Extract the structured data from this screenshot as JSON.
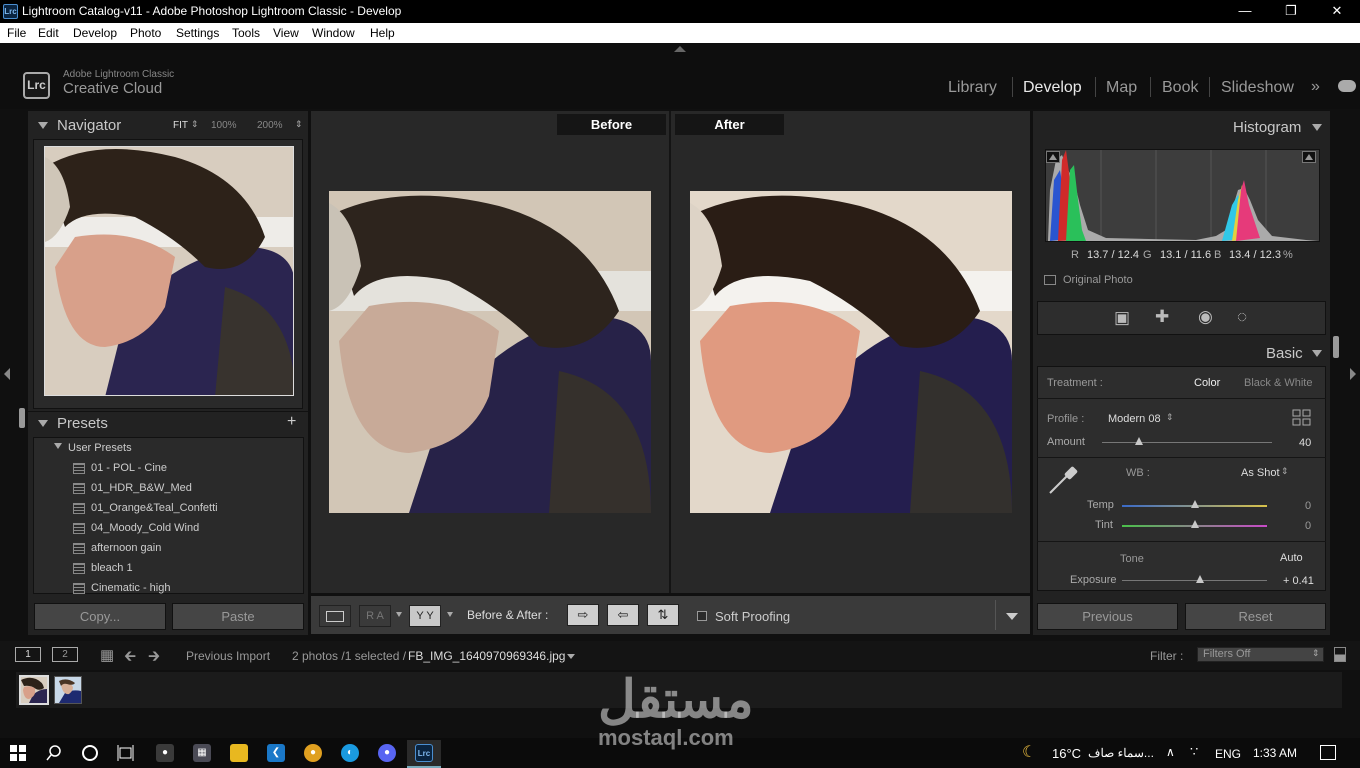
{
  "window": {
    "title": "Lightroom Catalog-v11 - Adobe Photoshop Lightroom Classic - Develop",
    "app_icon": "Lrc"
  },
  "menu": [
    "File",
    "Edit",
    "Develop",
    "Photo",
    "Settings",
    "Tools",
    "View",
    "Window",
    "Help"
  ],
  "identity": {
    "logo": "Lrc",
    "line1": "Adobe Lightroom Classic",
    "line2": "Creative Cloud"
  },
  "modules": [
    "Library",
    "Develop",
    "Map",
    "Book",
    "Slideshow"
  ],
  "active_module": "Develop",
  "navigator": {
    "title": "Navigator",
    "fit": "FIT",
    "zoom1": "100%",
    "zoom2": "200%"
  },
  "presets": {
    "title": "Presets",
    "group": "User Presets",
    "items": [
      "01 - POL - Cine",
      "01_HDR_B&W_Med",
      "01_Orange&Teal_Confetti",
      "04_Moody_Cold Wind",
      "afternoon gain",
      "bleach 1",
      "Cinematic - high"
    ]
  },
  "left_buttons": {
    "copy": "Copy...",
    "paste": "Paste"
  },
  "compare": {
    "before": "Before",
    "after": "After"
  },
  "toolbar": {
    "before_after": "Before & After :",
    "soft_proofing": "Soft Proofing",
    "ra": "R A",
    "yy": "Y Y"
  },
  "histogram": {
    "title": "Histogram",
    "r_label": "R",
    "r_value": "13.7 / 12.4",
    "g_label": "G",
    "g_value": "13.1 / 11.6",
    "b_label": "B",
    "b_value": "13.4 / 12.3",
    "pct": "%",
    "original_photo": "Original Photo"
  },
  "basic": {
    "title": "Basic",
    "treatment_label": "Treatment :",
    "treatment_color": "Color",
    "treatment_bw": "Black & White",
    "profile_label": "Profile :",
    "profile_value": "Modern 08",
    "amount_label": "Amount",
    "amount_value": "40",
    "wb_label": "WB :",
    "wb_value": "As Shot",
    "temp_label": "Temp",
    "temp_value": "0",
    "tint_label": "Tint",
    "tint_value": "0",
    "tone_label": "Tone",
    "auto_label": "Auto",
    "exposure_label": "Exposure",
    "exposure_value": "+ 0.41"
  },
  "right_buttons": {
    "previous": "Previous",
    "reset": "Reset"
  },
  "filmstrip": {
    "view1": "1",
    "view2": "2",
    "source": "Previous Import",
    "count": "2 photos /1 selected /",
    "filename": "FB_IMG_1640970969346.jpg",
    "filter_label": "Filter :",
    "filter_value": "Filters Off"
  },
  "watermark": {
    "arabic": "مستقل",
    "latin": "mostaql.com"
  },
  "taskbar": {
    "temp": "16°C",
    "weather": "سماء صاف...",
    "lang": "ENG",
    "time": "1:33 AM"
  },
  "colors": {
    "accent": "#e8e8e8",
    "panel": "#222222",
    "background": "#101010"
  }
}
